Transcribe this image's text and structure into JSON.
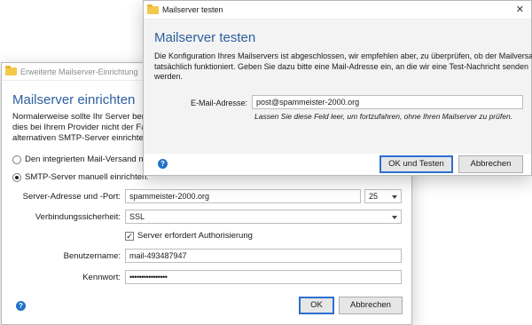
{
  "back_window": {
    "title": "Erweiterte Mailserver-Einrichtung",
    "heading": "Mailserver einrichten",
    "desc_lines": [
      "Normalerweise sollte Ihr Server bereits u",
      "dies bei Ihrem Provider nicht der Fall ist",
      "alternativen SMTP-Server einrichten."
    ],
    "radio_integrated": "Den integrierten Mail-Versand nutze",
    "radio_smtp": "SMTP-Server manuell einrichten:",
    "server_label": "Server-Adresse und -Port:",
    "server_value": "spammeister-2000.org",
    "port_value": "25",
    "security_label": "Verbindungssicherheit:",
    "security_value": "SSL",
    "auth_checkbox": "Server erfordert Authorisierung",
    "user_label": "Benutzername:",
    "user_value": "mail-493487947",
    "password_label": "Kennwort:",
    "password_value": "••••••••••••••••",
    "ok_button": "OK",
    "cancel_button": "Abbrechen",
    "help_glyph": "?"
  },
  "front_window": {
    "title": "Mailserver testen",
    "close_glyph": "✕",
    "heading": "Mailserver testen",
    "desc_lines": [
      "Die Konfiguration Ihres Mailservers ist abgeschlossen, wir empfehlen aber, zu überprüfen, ob der Mailversand",
      "tatsächlich funktioniert. Geben Sie dazu bitte eine Mail-Adresse ein, an die wir eine Test-Nachricht senden",
      "werden."
    ],
    "email_label": "E-Mail-Adresse:",
    "email_value": "post@spammeister-2000.org",
    "hint": "Lassen Sie diese Feld leer, um fortzufahren, ohne Ihren Mailserver zu prüfen.",
    "ok_test_button": "OK und Testen",
    "cancel_button": "Abbrechen",
    "help_glyph": "?"
  }
}
